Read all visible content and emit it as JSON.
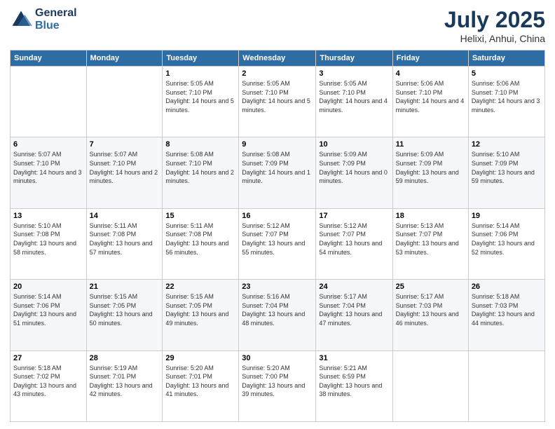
{
  "header": {
    "logo_line1": "General",
    "logo_line2": "Blue",
    "title": "July 2025",
    "subtitle": "Helixi, Anhui, China"
  },
  "weekdays": [
    "Sunday",
    "Monday",
    "Tuesday",
    "Wednesday",
    "Thursday",
    "Friday",
    "Saturday"
  ],
  "weeks": [
    [
      {
        "day": "",
        "detail": ""
      },
      {
        "day": "",
        "detail": ""
      },
      {
        "day": "1",
        "detail": "Sunrise: 5:05 AM\nSunset: 7:10 PM\nDaylight: 14 hours and 5 minutes."
      },
      {
        "day": "2",
        "detail": "Sunrise: 5:05 AM\nSunset: 7:10 PM\nDaylight: 14 hours and 5 minutes."
      },
      {
        "day": "3",
        "detail": "Sunrise: 5:05 AM\nSunset: 7:10 PM\nDaylight: 14 hours and 4 minutes."
      },
      {
        "day": "4",
        "detail": "Sunrise: 5:06 AM\nSunset: 7:10 PM\nDaylight: 14 hours and 4 minutes."
      },
      {
        "day": "5",
        "detail": "Sunrise: 5:06 AM\nSunset: 7:10 PM\nDaylight: 14 hours and 3 minutes."
      }
    ],
    [
      {
        "day": "6",
        "detail": "Sunrise: 5:07 AM\nSunset: 7:10 PM\nDaylight: 14 hours and 3 minutes."
      },
      {
        "day": "7",
        "detail": "Sunrise: 5:07 AM\nSunset: 7:10 PM\nDaylight: 14 hours and 2 minutes."
      },
      {
        "day": "8",
        "detail": "Sunrise: 5:08 AM\nSunset: 7:10 PM\nDaylight: 14 hours and 2 minutes."
      },
      {
        "day": "9",
        "detail": "Sunrise: 5:08 AM\nSunset: 7:09 PM\nDaylight: 14 hours and 1 minute."
      },
      {
        "day": "10",
        "detail": "Sunrise: 5:09 AM\nSunset: 7:09 PM\nDaylight: 14 hours and 0 minutes."
      },
      {
        "day": "11",
        "detail": "Sunrise: 5:09 AM\nSunset: 7:09 PM\nDaylight: 13 hours and 59 minutes."
      },
      {
        "day": "12",
        "detail": "Sunrise: 5:10 AM\nSunset: 7:09 PM\nDaylight: 13 hours and 59 minutes."
      }
    ],
    [
      {
        "day": "13",
        "detail": "Sunrise: 5:10 AM\nSunset: 7:08 PM\nDaylight: 13 hours and 58 minutes."
      },
      {
        "day": "14",
        "detail": "Sunrise: 5:11 AM\nSunset: 7:08 PM\nDaylight: 13 hours and 57 minutes."
      },
      {
        "day": "15",
        "detail": "Sunrise: 5:11 AM\nSunset: 7:08 PM\nDaylight: 13 hours and 56 minutes."
      },
      {
        "day": "16",
        "detail": "Sunrise: 5:12 AM\nSunset: 7:07 PM\nDaylight: 13 hours and 55 minutes."
      },
      {
        "day": "17",
        "detail": "Sunrise: 5:12 AM\nSunset: 7:07 PM\nDaylight: 13 hours and 54 minutes."
      },
      {
        "day": "18",
        "detail": "Sunrise: 5:13 AM\nSunset: 7:07 PM\nDaylight: 13 hours and 53 minutes."
      },
      {
        "day": "19",
        "detail": "Sunrise: 5:14 AM\nSunset: 7:06 PM\nDaylight: 13 hours and 52 minutes."
      }
    ],
    [
      {
        "day": "20",
        "detail": "Sunrise: 5:14 AM\nSunset: 7:06 PM\nDaylight: 13 hours and 51 minutes."
      },
      {
        "day": "21",
        "detail": "Sunrise: 5:15 AM\nSunset: 7:05 PM\nDaylight: 13 hours and 50 minutes."
      },
      {
        "day": "22",
        "detail": "Sunrise: 5:15 AM\nSunset: 7:05 PM\nDaylight: 13 hours and 49 minutes."
      },
      {
        "day": "23",
        "detail": "Sunrise: 5:16 AM\nSunset: 7:04 PM\nDaylight: 13 hours and 48 minutes."
      },
      {
        "day": "24",
        "detail": "Sunrise: 5:17 AM\nSunset: 7:04 PM\nDaylight: 13 hours and 47 minutes."
      },
      {
        "day": "25",
        "detail": "Sunrise: 5:17 AM\nSunset: 7:03 PM\nDaylight: 13 hours and 46 minutes."
      },
      {
        "day": "26",
        "detail": "Sunrise: 5:18 AM\nSunset: 7:03 PM\nDaylight: 13 hours and 44 minutes."
      }
    ],
    [
      {
        "day": "27",
        "detail": "Sunrise: 5:18 AM\nSunset: 7:02 PM\nDaylight: 13 hours and 43 minutes."
      },
      {
        "day": "28",
        "detail": "Sunrise: 5:19 AM\nSunset: 7:01 PM\nDaylight: 13 hours and 42 minutes."
      },
      {
        "day": "29",
        "detail": "Sunrise: 5:20 AM\nSunset: 7:01 PM\nDaylight: 13 hours and 41 minutes."
      },
      {
        "day": "30",
        "detail": "Sunrise: 5:20 AM\nSunset: 7:00 PM\nDaylight: 13 hours and 39 minutes."
      },
      {
        "day": "31",
        "detail": "Sunrise: 5:21 AM\nSunset: 6:59 PM\nDaylight: 13 hours and 38 minutes."
      },
      {
        "day": "",
        "detail": ""
      },
      {
        "day": "",
        "detail": ""
      }
    ]
  ]
}
